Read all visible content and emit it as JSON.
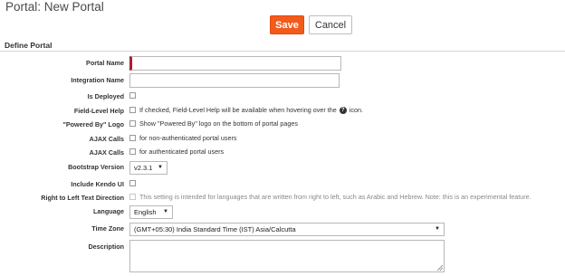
{
  "page": {
    "title": "Portal: New Portal"
  },
  "toolbar": {
    "save_label": "Save",
    "cancel_label": "Cancel"
  },
  "section": {
    "title": "Define Portal"
  },
  "fields": {
    "portal_name": {
      "label": "Portal Name",
      "value": ""
    },
    "integration_name": {
      "label": "Integration Name",
      "value": ""
    },
    "is_deployed": {
      "label": "Is Deployed",
      "checked": false
    },
    "field_level_help": {
      "label": "Field-Level Help",
      "text_before": "If checked, Field-Level Help will be available when hovering over the",
      "icon": "question-icon",
      "text_after": "icon.",
      "checked": false
    },
    "powered_by_logo": {
      "label": "\"Powered By\" Logo",
      "text": "Show \"Powered By\" logo on the bottom of portal pages",
      "checked": false
    },
    "ajax_calls_non_auth": {
      "label": "AJAX Calls",
      "text": "for non-authenticated portal users",
      "checked": false
    },
    "ajax_calls_auth": {
      "label": "AJAX Calls",
      "text": "for authenticated portal users",
      "checked": false
    },
    "bootstrap_version": {
      "label": "Bootstrap Version",
      "value": "v2.3.1"
    },
    "include_kendo_ui": {
      "label": "Include Kendo UI",
      "checked": false
    },
    "rtl_direction": {
      "label": "Right to Left Text Direction",
      "text": "This setting is intended for languages that are written from right to left, such as Arabic and Hebrew. Note: this is an experimental feature.",
      "checked": false,
      "disabled": true
    },
    "language": {
      "label": "Language",
      "value": "English"
    },
    "time_zone": {
      "label": "Time Zone",
      "value": "(GMT+05:30) India Standard Time (IST) Asia/Calcutta"
    },
    "description": {
      "label": "Description",
      "value": ""
    }
  },
  "colors": {
    "accent": "#f25b1c",
    "required": "#b01e2a"
  }
}
